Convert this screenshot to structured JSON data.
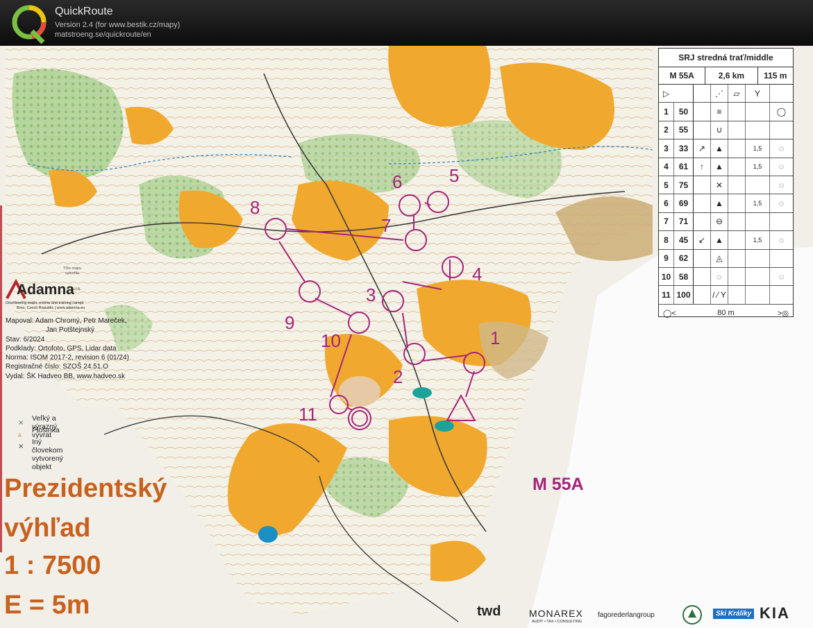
{
  "app": {
    "name": "QuickRoute",
    "version": "Version 2.4  (for www.bestik.cz/mapy)",
    "url": "matstroeng.se/quickroute/en"
  },
  "map": {
    "organizer_logo": "Adamna",
    "organizer_suffix": "s.r.o.",
    "organizer_tagline": "Orienteering maps, events and training camps",
    "organizer_contact": "Brno, Czech Republic  |  www.adamna.eu",
    "stamp": "Tůto mapu vytvořila",
    "credits": [
      "Mapoval: Adam Chromý, Petr Mareček,",
      "Jan Potštejnský",
      "Stav: 6/2024",
      "Podklady: Ortofoto, GPS, Lidar data",
      "Norma: ISOM 2017-2, revision 6 (01/24)",
      "Registračné číslo: SZOŠ 24.51.O",
      "Vydal: ŠK Hadveo BB, www.hadveo.sk"
    ],
    "legend": [
      {
        "symbol": "×",
        "color": "#2e8b2e",
        "text": "Veľký a výrazný vývrat"
      },
      {
        "symbol": "▵",
        "color": "#c7611d",
        "text": "Plošinka"
      },
      {
        "symbol": "×",
        "color": "#333333",
        "text": "Iný človekom vytvorený objekt"
      }
    ],
    "map_name_line1": "Prezidentský",
    "map_name_line2": "výhľad",
    "scale": "1 : 7500",
    "equidistance": "E = 5m",
    "course_label": "M 55A",
    "control_numbers": [
      "1",
      "2",
      "3",
      "4",
      "5",
      "6",
      "7",
      "8",
      "9",
      "10",
      "11"
    ],
    "sponsors": [
      "twd",
      "MONAREX",
      "AUDIT • TAX • CONSULTING",
      "fagorederlangroup",
      "Ski Králiky",
      "KIA"
    ],
    "course_color": "#a4247a"
  },
  "description": {
    "title": "SRJ stredná trať/middle",
    "class": "M 55A",
    "length": "2,6 km",
    "climb": "115 m",
    "start_code": "",
    "controls": [
      {
        "n": "1",
        "code": "50",
        "dir": "",
        "feat": "≡",
        "size": "",
        "detail": "◯̣"
      },
      {
        "n": "2",
        "code": "55",
        "dir": "",
        "feat": "∪",
        "size": "",
        "detail": ""
      },
      {
        "n": "3",
        "code": "33",
        "dir": "↗",
        "feat": "▲",
        "size": "1,5",
        "detail": "◌"
      },
      {
        "n": "4",
        "code": "61",
        "dir": "↑",
        "feat": "▲",
        "size": "1,5",
        "detail": "◌"
      },
      {
        "n": "5",
        "code": "75",
        "dir": "",
        "feat": "✕",
        "size": "",
        "detail": "◌"
      },
      {
        "n": "6",
        "code": "69",
        "dir": "",
        "feat": "▲",
        "size": "1,5",
        "detail": "◌"
      },
      {
        "n": "7",
        "code": "71",
        "dir": "",
        "feat": "⊖",
        "size": "",
        "detail": ""
      },
      {
        "n": "8",
        "code": "45",
        "dir": "↙",
        "feat": "▲",
        "size": "1,5",
        "detail": "◌"
      },
      {
        "n": "9",
        "code": "62",
        "dir": "",
        "feat": "◬",
        "size": "",
        "detail": ""
      },
      {
        "n": "10",
        "code": "58",
        "dir": "",
        "feat": "◌",
        "size": "",
        "detail": "◌"
      },
      {
        "n": "11",
        "code": "100",
        "dir": "",
        "feat": "/ ⁄ Y",
        "size": "",
        "detail": ""
      }
    ],
    "finish_text": "80 m"
  }
}
